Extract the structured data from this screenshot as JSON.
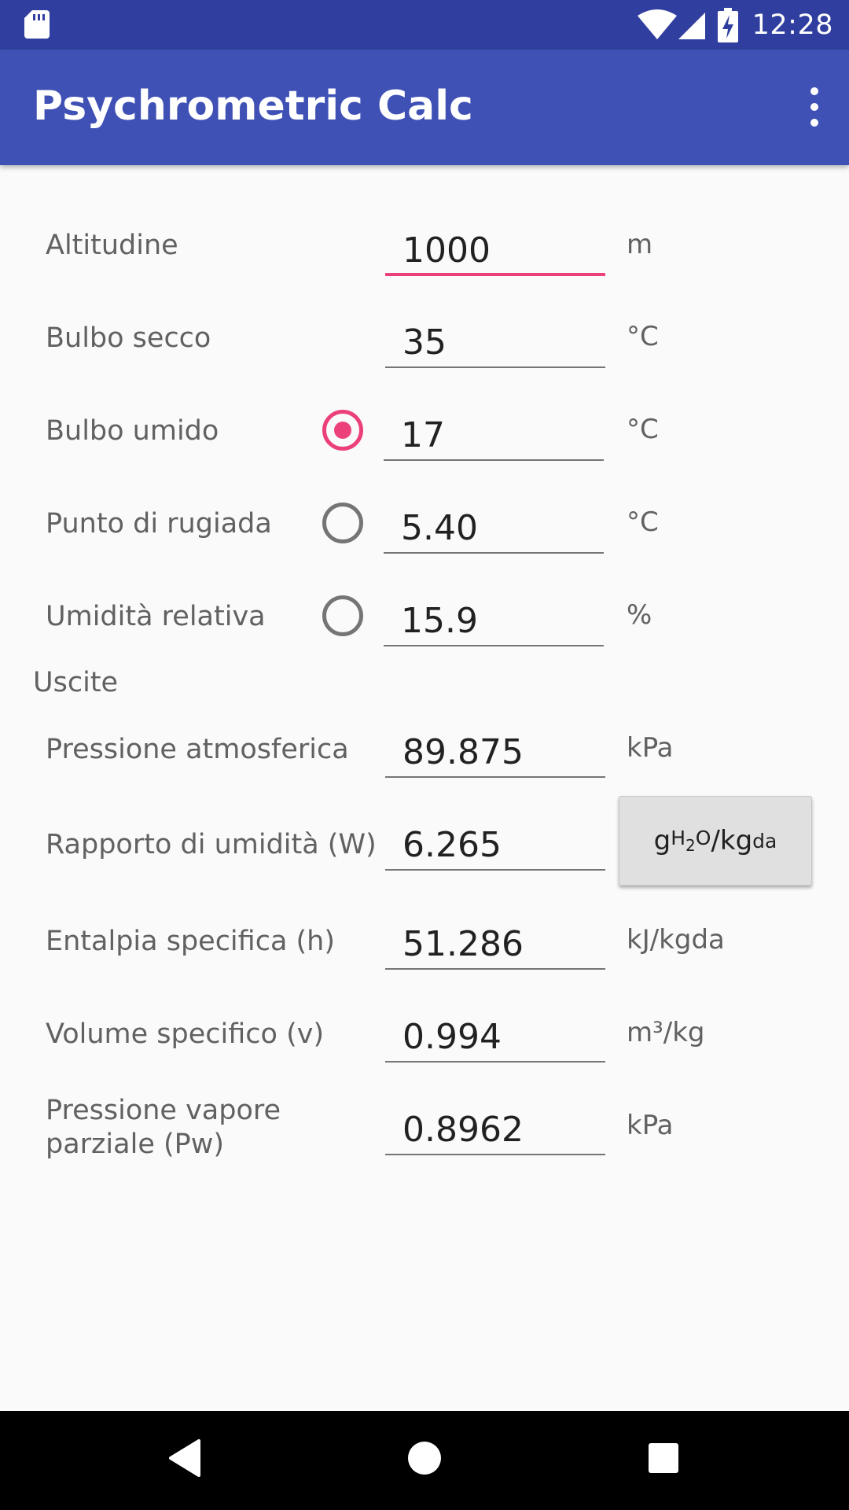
{
  "status_bar": {
    "time": "12:28",
    "icons": [
      "sd-card-icon",
      "wifi-icon",
      "signal-icon",
      "battery-charging-icon"
    ]
  },
  "app_bar": {
    "title": "Psychrometric Calc",
    "menu_icon": "more-vert-icon"
  },
  "inputs": {
    "altitude": {
      "label": "Altitudine",
      "value": "1000",
      "unit": "m"
    },
    "dry_bulb": {
      "label": "Bulbo secco",
      "value": "35",
      "unit": "°C"
    },
    "wet_bulb": {
      "label": "Bulbo umido",
      "value": "17",
      "unit": "°C",
      "selected": true
    },
    "dew_point": {
      "label": "Punto di rugiada",
      "value": "5.40",
      "unit": "°C",
      "selected": false
    },
    "relative_humidity": {
      "label": "Umidità relativa",
      "value": "15.9",
      "unit": "%",
      "selected": false
    }
  },
  "outputs": {
    "section_title": "Uscite",
    "atm_pressure": {
      "label": "Pressione atmosferica",
      "value": "89.875",
      "unit": "kPa"
    },
    "humidity_ratio": {
      "label": "Rapporto di umidità (W)",
      "value": "6.265",
      "unit_g": "g",
      "unit_h": "H",
      "unit_2": "2",
      "unit_o": "O",
      "unit_kg": "/kg",
      "unit_da": "da"
    },
    "enthalpy": {
      "label": "Entalpia specifica (h)",
      "value": "51.286",
      "unit": "kJ/kgda"
    },
    "specific_volume": {
      "label": "Volume specifico (v)",
      "value": "0.994",
      "unit": "m³/kg"
    },
    "vapor_pressure": {
      "label_line1": "Pressione vapore",
      "label_line2": "parziale (Pw)",
      "value": "0.8962",
      "unit": "kPa"
    }
  },
  "nav_bar": {
    "icons": [
      "back-icon",
      "home-icon",
      "recents-icon"
    ]
  },
  "colors": {
    "primary": "#3f51b5",
    "primary_dark": "#303f9f",
    "accent": "#ec407a"
  }
}
